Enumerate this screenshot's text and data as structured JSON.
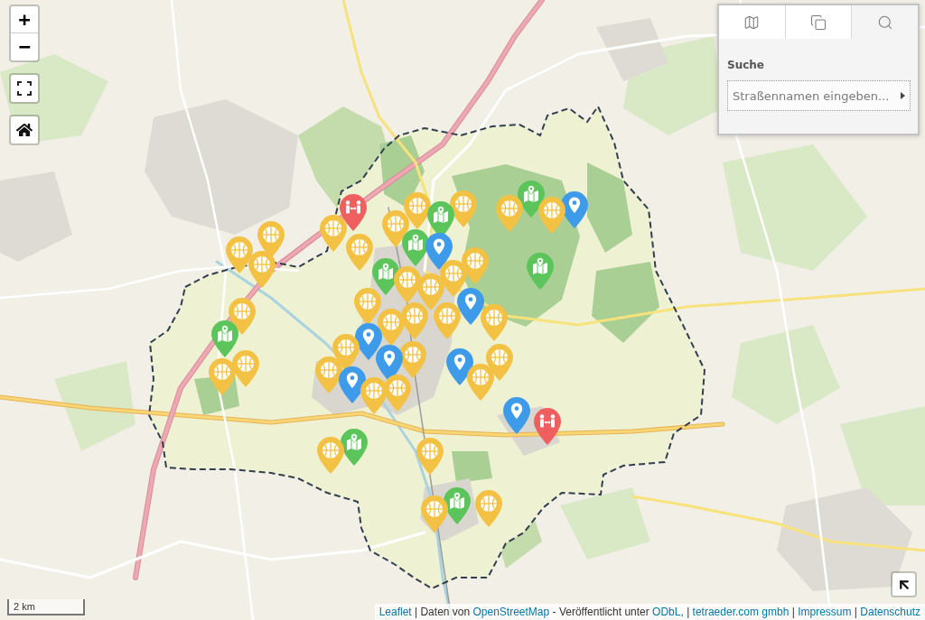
{
  "map_controls": {
    "zoom_in": "+",
    "zoom_out": "−"
  },
  "search_panel": {
    "tabs": [
      {
        "kind": "map",
        "selected": false
      },
      {
        "kind": "copy",
        "selected": false
      },
      {
        "kind": "search",
        "selected": true
      }
    ],
    "label": "Suche",
    "field": {
      "placeholder": "Straßennamen eingeben..."
    }
  },
  "markers": [
    {
      "kind": "basketball",
      "color": "#f3c244"
    },
    {
      "kind": "basketball",
      "color": "#f3c244"
    },
    {
      "kind": "basketball",
      "color": "#f3c244"
    },
    {
      "kind": "people",
      "color": "#ef5f60"
    },
    {
      "kind": "basketball",
      "color": "#f3c244"
    },
    {
      "kind": "basketball",
      "color": "#f3c244"
    },
    {
      "kind": "basketball",
      "color": "#f3c244"
    },
    {
      "kind": "basketball",
      "color": "#f3c244"
    },
    {
      "kind": "map",
      "color": "#5bc55b"
    },
    {
      "kind": "map",
      "color": "#5bc55b"
    },
    {
      "kind": "basketball",
      "color": "#f3c244"
    },
    {
      "kind": "basketball",
      "color": "#f3c244"
    },
    {
      "kind": "map",
      "color": "#5bc55b"
    },
    {
      "kind": "location",
      "color": "#3d9be9"
    },
    {
      "kind": "basketball",
      "color": "#f3c244"
    },
    {
      "kind": "location",
      "color": "#3d9be9"
    },
    {
      "kind": "basketball",
      "color": "#f3c244"
    },
    {
      "kind": "map",
      "color": "#5bc55b"
    },
    {
      "kind": "map",
      "color": "#5bc55b"
    },
    {
      "kind": "basketball",
      "color": "#f3c244"
    },
    {
      "kind": "basketball",
      "color": "#f3c244"
    },
    {
      "kind": "basketball",
      "color": "#f3c244"
    },
    {
      "kind": "basketball",
      "color": "#f3c244"
    },
    {
      "kind": "location",
      "color": "#3d9be9"
    },
    {
      "kind": "basketball",
      "color": "#f3c244"
    },
    {
      "kind": "basketball",
      "color": "#f3c244"
    },
    {
      "kind": "basketball",
      "color": "#f3c244"
    },
    {
      "kind": "basketball",
      "color": "#f3c244"
    },
    {
      "kind": "basketball",
      "color": "#f3c244"
    },
    {
      "kind": "map",
      "color": "#5bc55b"
    },
    {
      "kind": "basketball",
      "color": "#f3c244"
    },
    {
      "kind": "basketball",
      "color": "#f3c244"
    },
    {
      "kind": "location",
      "color": "#3d9be9"
    },
    {
      "kind": "basketball",
      "color": "#f3c244"
    },
    {
      "kind": "basketball",
      "color": "#f3c244"
    },
    {
      "kind": "location",
      "color": "#3d9be9"
    },
    {
      "kind": "basketball",
      "color": "#f3c244"
    },
    {
      "kind": "location",
      "color": "#3d9be9"
    },
    {
      "kind": "basketball",
      "color": "#f3c244"
    },
    {
      "kind": "basketball",
      "color": "#f3c244"
    },
    {
      "kind": "basketball",
      "color": "#f3c244"
    },
    {
      "kind": "location",
      "color": "#3d9be9"
    },
    {
      "kind": "basketball",
      "color": "#f3c244"
    },
    {
      "kind": "location",
      "color": "#3d9be9"
    },
    {
      "kind": "people",
      "color": "#ef5f60"
    },
    {
      "kind": "map",
      "color": "#5bc55b"
    },
    {
      "kind": "basketball",
      "color": "#f3c244"
    },
    {
      "kind": "basketball",
      "color": "#f3c244"
    },
    {
      "kind": "map",
      "color": "#5bc55b"
    },
    {
      "kind": "basketball",
      "color": "#f3c244"
    },
    {
      "kind": "basketball",
      "color": "#f3c244"
    }
  ],
  "scale": "2 km",
  "attribution": [
    {
      "kind": "link",
      "text": "Leaflet"
    },
    {
      "kind": "text",
      "text": "| Daten von"
    },
    {
      "kind": "link",
      "text": "OpenStreetMap"
    },
    {
      "kind": "text",
      "text": "- Veröffentlicht unter"
    },
    {
      "kind": "link",
      "text": "ODbL,"
    },
    {
      "kind": "text",
      "text": "|"
    },
    {
      "kind": "link",
      "text": "tetraeder.com gmbh"
    },
    {
      "kind": "text",
      "text": "|"
    },
    {
      "kind": "link",
      "text": "Impressum"
    },
    {
      "kind": "text",
      "text": "|"
    },
    {
      "kind": "link",
      "text": "Datenschutz"
    }
  ]
}
